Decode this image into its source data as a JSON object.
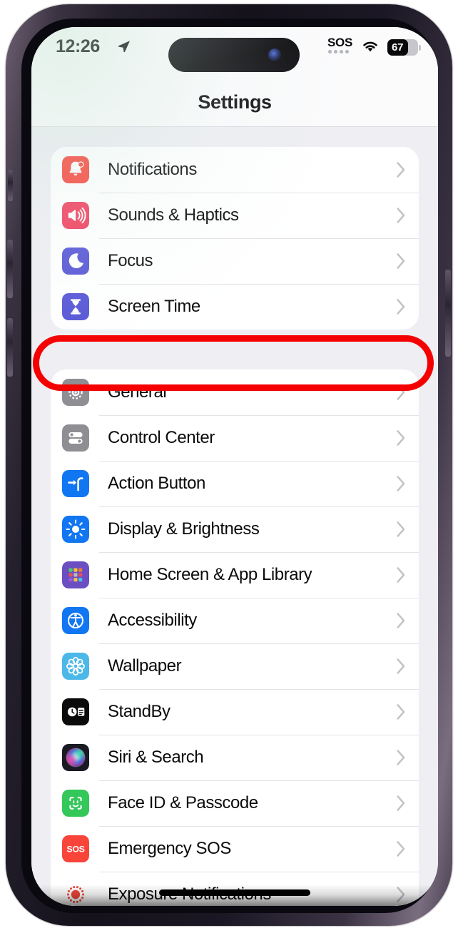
{
  "status_bar": {
    "time": "12:26",
    "location_icon": "location-arrow-icon",
    "sos_label": "SOS",
    "wifi_icon": "wifi-icon",
    "battery_level": "67",
    "battery_percent": 67
  },
  "nav": {
    "title": "Settings"
  },
  "colors": {
    "accent_highlight": "#f40000",
    "screen_background": "#eeeef3",
    "card_background": "#ffffff",
    "separator": "#e3e3e8",
    "chevron": "#c2c2c8"
  },
  "annotation": {
    "type": "red-oval-highlight",
    "target_row": "Focus",
    "color": "#f40000"
  },
  "groups": [
    {
      "id": "group-1",
      "rows": [
        {
          "label": "Notifications",
          "icon": "bell-icon",
          "icon_bg": "#f9443a",
          "chevron": true
        },
        {
          "label": "Sounds & Haptics",
          "icon": "speaker-wave-icon",
          "icon_bg": "#f03e5c",
          "chevron": true
        },
        {
          "label": "Focus",
          "icon": "moon-icon",
          "icon_bg": "#5756d6",
          "chevron": true,
          "highlighted": true
        },
        {
          "label": "Screen Time",
          "icon": "hourglass-icon",
          "icon_bg": "#5756d6",
          "chevron": true
        }
      ]
    },
    {
      "id": "group-2",
      "rows": [
        {
          "label": "General",
          "icon": "gear-icon",
          "icon_bg": "#8e8e93",
          "chevron": true
        },
        {
          "label": "Control Center",
          "icon": "sliders-icon",
          "icon_bg": "#8e8e93",
          "chevron": true
        },
        {
          "label": "Action Button",
          "icon": "action-button-icon",
          "icon_bg": "#1176f1",
          "chevron": true
        },
        {
          "label": "Display & Brightness",
          "icon": "sun-icon",
          "icon_bg": "#1176f1",
          "chevron": true
        },
        {
          "label": "Home Screen & App Library",
          "icon": "app-grid-icon",
          "icon_bg": "#6a4ec2",
          "chevron": true
        },
        {
          "label": "Accessibility",
          "icon": "accessibility-icon",
          "icon_bg": "#1176f1",
          "chevron": true
        },
        {
          "label": "Wallpaper",
          "icon": "flower-icon",
          "icon_bg": "#4cb8e8",
          "chevron": true
        },
        {
          "label": "StandBy",
          "icon": "standby-clock-icon",
          "icon_bg": "#0b0b0b",
          "chevron": true
        },
        {
          "label": "Siri & Search",
          "icon": "siri-orb-icon",
          "icon_bg": "#1a1a22",
          "chevron": true
        },
        {
          "label": "Face ID & Passcode",
          "icon": "face-id-icon",
          "icon_bg": "#34c75a",
          "chevron": true
        },
        {
          "label": "Emergency SOS",
          "icon": "sos-icon",
          "icon_bg": "#f9443a",
          "chevron": true
        },
        {
          "label": "Exposure Notifications",
          "icon": "exposure-dot-icon",
          "icon_bg": "#ffffff",
          "chevron": true
        }
      ]
    }
  ]
}
